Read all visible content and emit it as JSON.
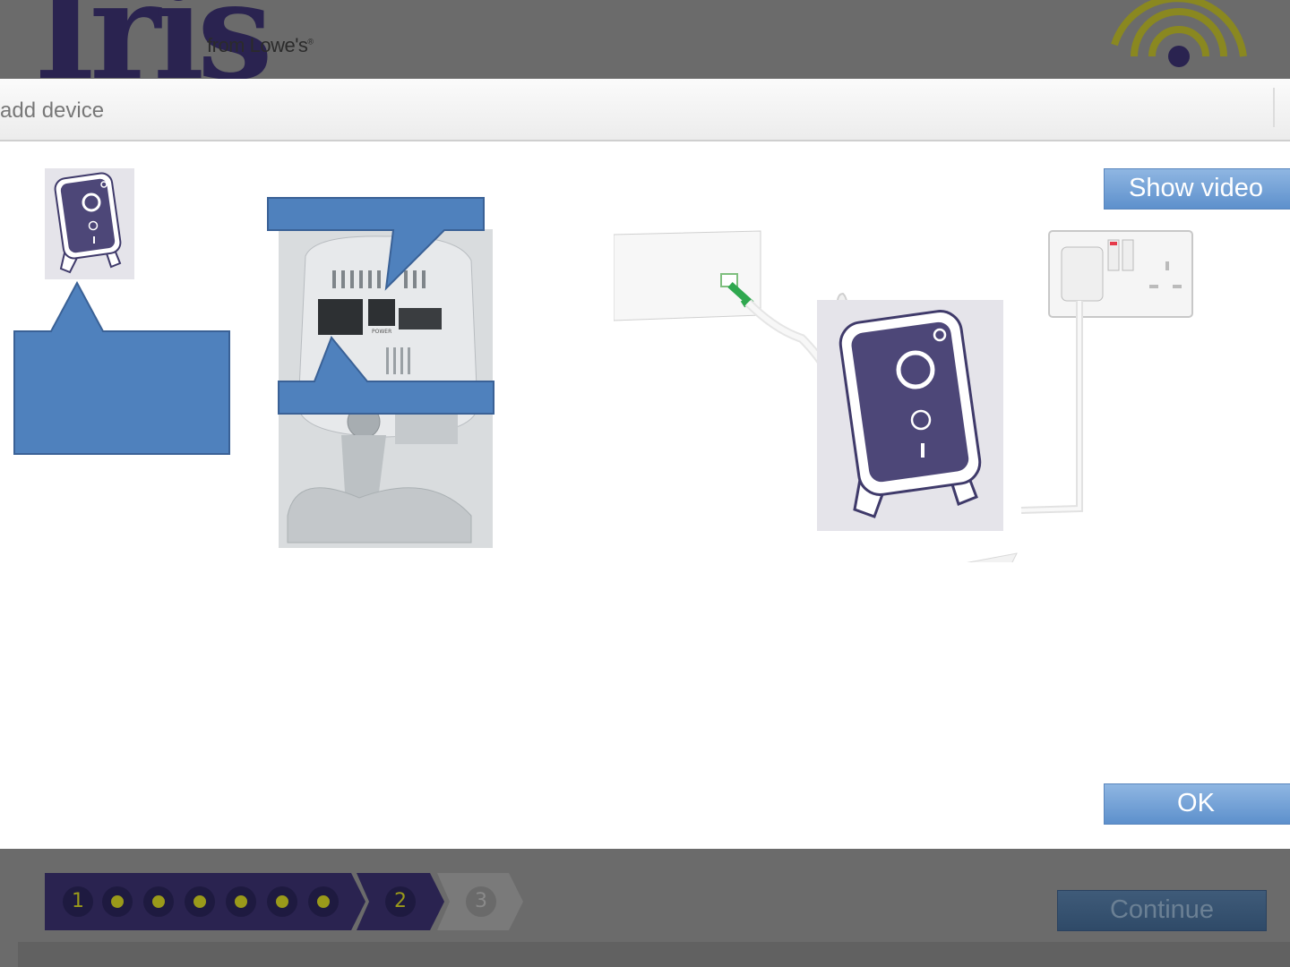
{
  "header": {
    "logo_text": "Iris",
    "logo_sub": "from Lowe's"
  },
  "modal": {
    "title": "add device",
    "show_video_label": "Show video",
    "ok_label": "OK"
  },
  "progress": {
    "step1": "1",
    "step2": "2",
    "step3": "3"
  },
  "footer": {
    "continue_label": "Continue"
  },
  "colors": {
    "brand_purple": "#2a2350",
    "callout_blue": "#4f81bd",
    "button_blue": "#5d90cc",
    "progress_accent": "#9a9a1a"
  },
  "icons": [
    "camera-icon",
    "camera-icon",
    "radio-waves-logo"
  ]
}
